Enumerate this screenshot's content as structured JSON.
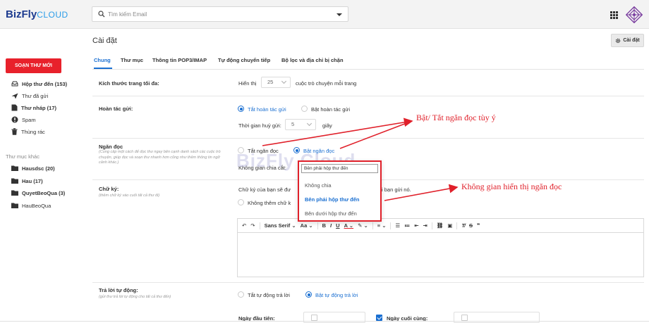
{
  "brand": {
    "name": "BizFly",
    "suffix": "CLOUD"
  },
  "search": {
    "placeholder": "Tìm kiếm Email"
  },
  "page_title": "Cài đặt",
  "settings_button": "Cài đặt",
  "compose_label": "SOẠN THƯ MỚI",
  "sidebar": {
    "items": [
      {
        "label": "Hộp thư đến (153)",
        "icon": "inbox-icon",
        "bold": true
      },
      {
        "label": "Thư đã gửi",
        "icon": "send-icon",
        "bold": false
      },
      {
        "label": "Thư nháp (17)",
        "icon": "draft-icon",
        "bold": true
      },
      {
        "label": "Spam",
        "icon": "spam-icon",
        "bold": false
      },
      {
        "label": "Thùng rác",
        "icon": "trash-icon",
        "bold": false
      }
    ],
    "folder_title": "Thư mục khác",
    "folders": [
      {
        "label": "Hausdsc (20)"
      },
      {
        "label": "Hau (17)"
      },
      {
        "label": "QuyetBeoQua (3)"
      },
      {
        "label": "HauBeoQua"
      }
    ]
  },
  "tabs": [
    {
      "label": "Chung",
      "active": true
    },
    {
      "label": "Thư mục"
    },
    {
      "label": "Thông tin POP3/IMAP"
    },
    {
      "label": "Tự động chuyển tiếp"
    },
    {
      "label": "Bộ lọc và địa chỉ bị chặn"
    }
  ],
  "settings": {
    "page_size": {
      "label": "Kích thước trang tối đa:",
      "prefix": "Hiển thị",
      "value": "25",
      "suffix": "cuộc trò chuyện mỗi trang"
    },
    "undo_send": {
      "label": "Hoàn tác gửi:",
      "option_on": "Tắt hoàn tác gửi",
      "option_off": "Bật hoàn tác gửi",
      "cancel_label": "Thời gian huỷ gửi:",
      "cancel_value": "5",
      "cancel_unit": "giây"
    },
    "reading_pane": {
      "label": "Ngăn đọc",
      "hint": "(Cung cấp một cách để đọc thư ngay bên cạnh danh sách các cuộc trò chuyện, giúp đọc và soạn thư nhanh hơn cũng như thêm thông tin ngữ cảnh khác.)",
      "option_off": "Tắt ngăn đọc",
      "option_on": "Bật ngăn đọc",
      "split_label": "Không gian chia cắt:",
      "split_value": "Bên phải hộp thư đến",
      "options": [
        "Không chia",
        "Bên phải hộp thư đến",
        "Bên dưới hộp thư đến"
      ],
      "selected_option": "Bên phải hộp thư đến"
    },
    "signature": {
      "label": "Chữ ký:",
      "hint": "(thêm chữ ký vào cuối tất cả thư đi)",
      "desc_left": "Chữ ký của bạn sẽ đư",
      "desc_right": "i bạn gửi nó.",
      "no_signature": "Không thêm chữ k",
      "font": "Sans Serif",
      "font_size": "Aa"
    },
    "auto_reply": {
      "label": "Trả lời tự động:",
      "hint": "(gửi thư trả lời tự động cho tất cả thư đến)",
      "option_off": "Tắt tự động trả lời",
      "option_on": "Bật tự động trả lời",
      "first_day": "Ngày đầu tiên:",
      "last_day": "Ngày cuối cùng:"
    }
  },
  "annotations": {
    "toggle": "Bật/ Tắt ngăn đọc tùy ý",
    "space": "Không gian hiển thị ngăn đọc"
  },
  "watermark": "BizFly Cloud",
  "colors": {
    "accent": "#1a6fd1",
    "brand_red": "#e8212b",
    "annotation": "#e0202a",
    "logo": "#1d3b8f"
  }
}
